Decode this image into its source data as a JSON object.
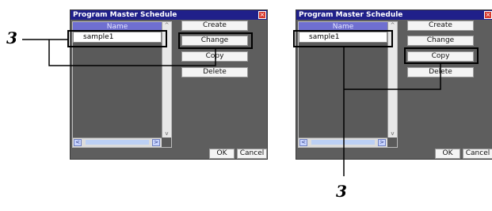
{
  "dialogs": [
    {
      "title": "Program Master Schedule",
      "list_header": "Name",
      "items": [
        "sample1"
      ],
      "buttons": [
        "Create",
        "Change",
        "Copy",
        "Delete"
      ],
      "ok_label": "OK",
      "cancel_label": "Cancel",
      "close_icon": "close-icon",
      "highlighted_button": "Change"
    },
    {
      "title": "Program Master Schedule",
      "list_header": "Name",
      "items": [
        "sample1"
      ],
      "buttons": [
        "Create",
        "Change",
        "Copy",
        "Delete"
      ],
      "ok_label": "OK",
      "cancel_label": "Cancel",
      "close_icon": "close-icon",
      "highlighted_button": "Copy"
    }
  ],
  "callouts": [
    {
      "label": "3"
    },
    {
      "label": "3"
    }
  ]
}
